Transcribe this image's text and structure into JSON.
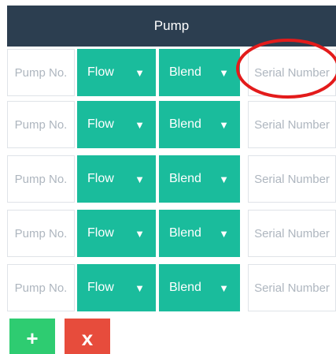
{
  "header": {
    "title": "Pump"
  },
  "rows": [
    {
      "pump_placeholder": "Pump No.",
      "flow_label": "Flow",
      "blend_label": "Blend",
      "serial_placeholder": "Serial Number"
    },
    {
      "pump_placeholder": "Pump No.",
      "flow_label": "Flow",
      "blend_label": "Blend",
      "serial_placeholder": "Serial Number"
    },
    {
      "pump_placeholder": "Pump No.",
      "flow_label": "Flow",
      "blend_label": "Blend",
      "serial_placeholder": "Serial Number"
    },
    {
      "pump_placeholder": "Pump No.",
      "flow_label": "Flow",
      "blend_label": "Blend",
      "serial_placeholder": "Serial Number"
    },
    {
      "pump_placeholder": "Pump No.",
      "flow_label": "Flow",
      "blend_label": "Blend",
      "serial_placeholder": "Serial Number"
    }
  ],
  "buttons": {
    "add": "+",
    "remove": "x"
  },
  "icons": {
    "dropdown": "caret-down-icon",
    "add": "plus-icon",
    "remove": "close-icon"
  },
  "colors": {
    "header": "#2c3e50",
    "select": "#1abc9c",
    "add": "#2ecc71",
    "remove": "#e74c3c",
    "annotation": "#e31b1b"
  }
}
